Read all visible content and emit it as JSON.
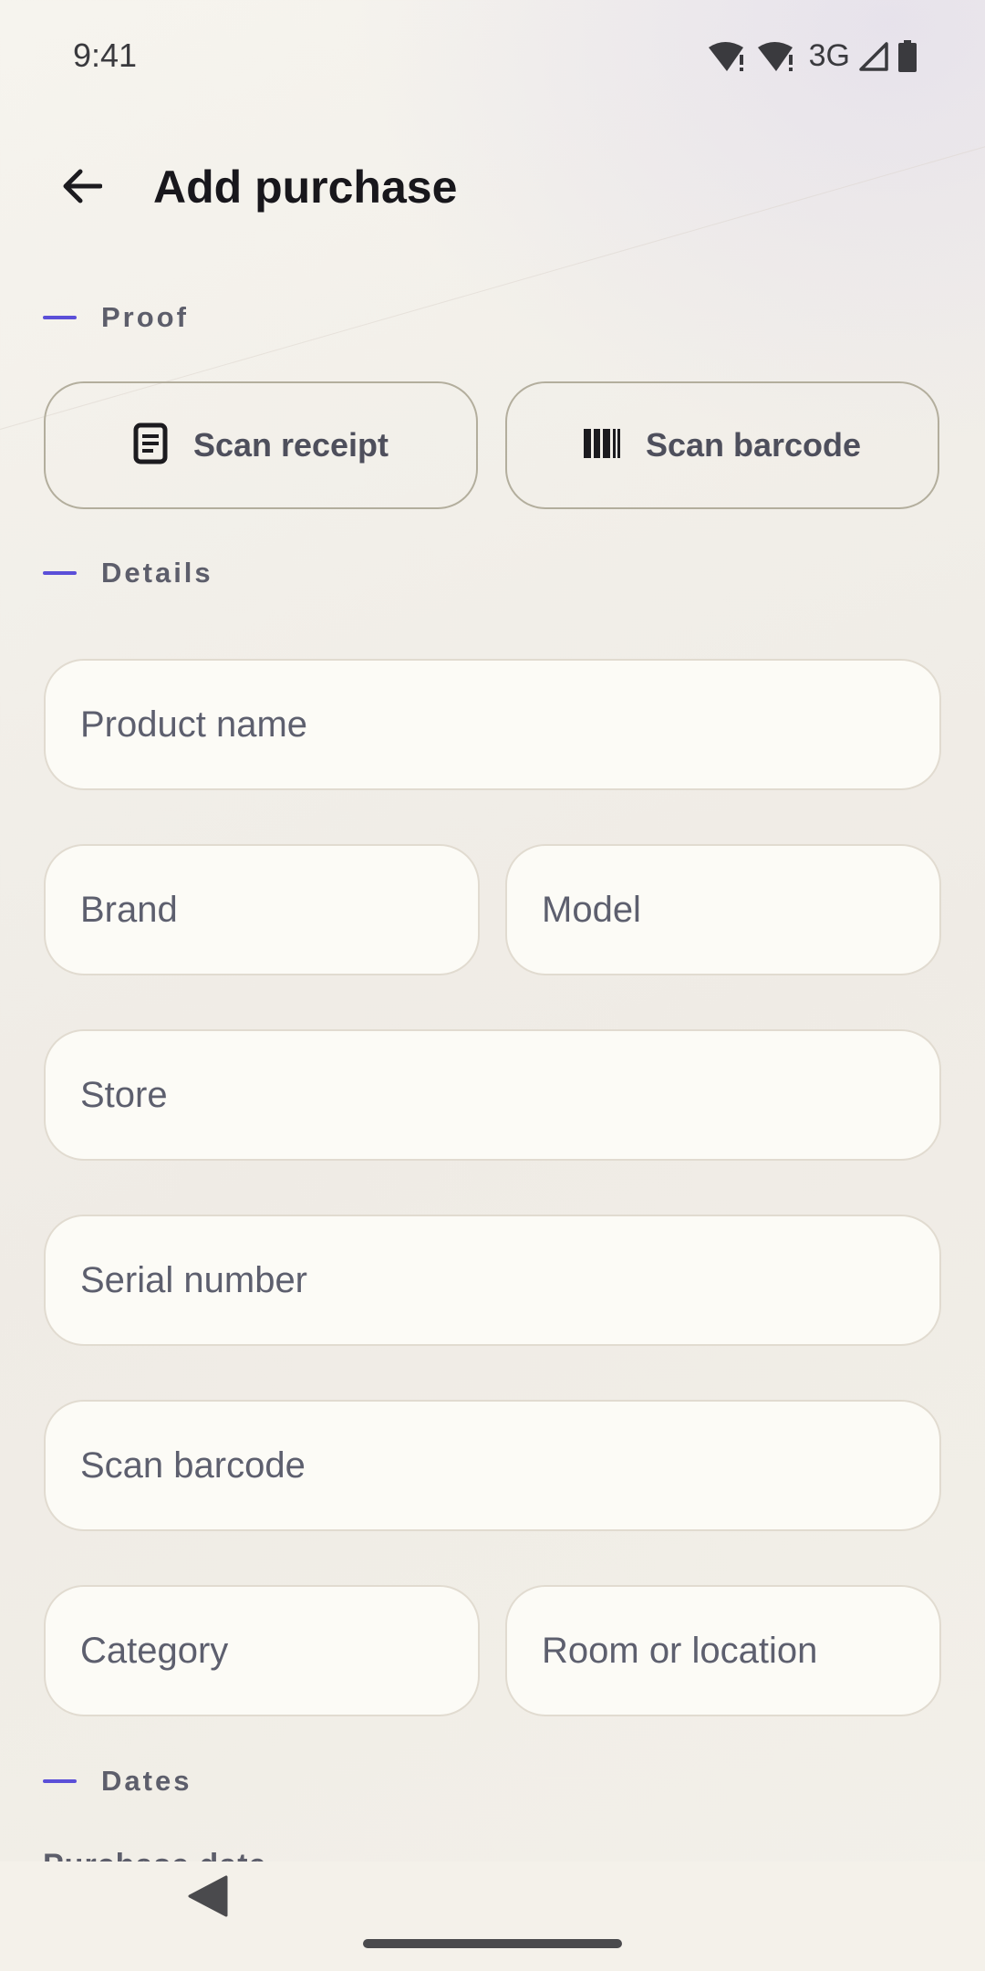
{
  "status_bar": {
    "time": "9:41",
    "network": "3G",
    "icons": [
      "wifi-alert-icon",
      "wifi-alert-icon",
      "cell-signal-icon",
      "battery-icon"
    ]
  },
  "app_bar": {
    "title": "Add purchase",
    "back_icon": "arrow-back-icon"
  },
  "sections": {
    "proof": "Proof",
    "details": "Details",
    "dates": "Dates"
  },
  "proof_buttons": {
    "scan_receipt": {
      "label": "Scan receipt",
      "icon": "receipt-icon"
    },
    "scan_barcode": {
      "label": "Scan barcode",
      "icon": "barcode-icon"
    }
  },
  "fields": {
    "product_name": {
      "placeholder": "Product name",
      "value": ""
    },
    "brand": {
      "placeholder": "Brand",
      "value": ""
    },
    "model": {
      "placeholder": "Model",
      "value": ""
    },
    "store": {
      "placeholder": "Store",
      "value": ""
    },
    "serial_number": {
      "placeholder": "Serial number",
      "value": ""
    },
    "barcode": {
      "placeholder": "Scan barcode",
      "value": ""
    },
    "category": {
      "placeholder": "Category",
      "value": ""
    },
    "location": {
      "placeholder": "Room or location",
      "value": ""
    }
  },
  "dates": {
    "purchase_date_label": "Purchase date"
  },
  "theme": {
    "accent": "#5b4fd8",
    "field_bg": "#fcfbf6",
    "outline": "#b3ae9d"
  },
  "nav_bar": {
    "back_icon": "nav-back-triangle-icon",
    "home": "home-pill"
  }
}
